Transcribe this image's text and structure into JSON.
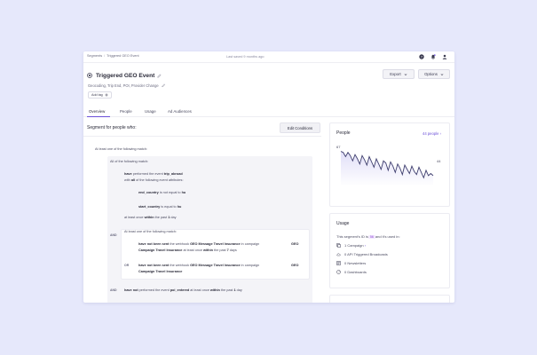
{
  "breadcrumb": {
    "root": "Segments",
    "current": "Triggered GEO Event"
  },
  "last_saved": "Last saved 9 months ago",
  "segment": {
    "title": "Triggered GEO Event",
    "subtitle": "Geocoding, Trip End, POI, Provider Change",
    "add_tag_label": "Add tag"
  },
  "buttons": {
    "export": "Export",
    "options": "Options",
    "edit_conditions": "Edit Conditions"
  },
  "tabs": [
    "Overview",
    "People",
    "Usage",
    "Ad Audiences"
  ],
  "conditions": {
    "heading": "Segment for people who:",
    "top_match": "At least one of the following match:",
    "all_match": "All of the following match:",
    "event1": {
      "pre": "have",
      "mid": " performed the event ",
      "event": "trip_abroad"
    },
    "event1_with": {
      "pre": "with ",
      "all": "all",
      "post": " of the following event attributes:"
    },
    "attr1": {
      "name": "end_country",
      "mid": " is not equal to ",
      "value": "hu"
    },
    "attr2": {
      "name": "start_country",
      "mid": " is equal to ",
      "value": "hu"
    },
    "freq1": {
      "pre": "at least once ",
      "within": "within",
      "mid": " the past ",
      "num": "1",
      "post": " day"
    },
    "and_label": "AND",
    "or_label": "OR",
    "inner_match": "At least one of the following match:",
    "webhook1": {
      "strong": "have not been sent",
      "mid": " the webhook ",
      "name": "GEO Message Travel Insurance",
      "mid2": " in campaign ",
      "campaign": "GEO Campaign Travel Insurance",
      "pre3": " at least once ",
      "within": "within",
      "mid3": " the past ",
      "num": "7",
      "post": " days"
    },
    "webhook2": {
      "strong": "have not been sent",
      "mid": " the webhook ",
      "name": "GEO Message Travel Insurance",
      "mid2": " in campaign ",
      "campaign": "GEO Campaign Travel Insurance"
    },
    "event2": {
      "pre": "have ",
      "not": "not",
      "mid": " performed the event ",
      "event": "poi_entered",
      "pre2": " at least once ",
      "within": "within",
      "mid2": " the past ",
      "num": "1",
      "post": " day"
    }
  },
  "people_card": {
    "title": "People",
    "count_link": "44 people ›",
    "chart_start_label": "67",
    "chart_end_label": "44"
  },
  "chart_data": {
    "type": "line",
    "x": [
      0,
      1,
      2,
      3,
      4,
      5,
      6,
      7,
      8,
      9,
      10,
      11,
      12,
      13,
      14,
      15,
      16,
      17,
      18,
      19,
      20,
      21,
      22,
      23,
      24,
      25,
      26,
      27,
      28,
      29,
      30,
      31,
      32,
      33,
      34,
      35,
      36,
      37,
      38,
      39
    ],
    "series": [
      {
        "values": [
          67,
          66,
          62,
          66,
          63,
          58,
          64,
          60,
          55,
          63,
          59,
          54,
          62,
          57,
          52,
          60,
          55,
          50,
          58,
          56,
          49,
          57,
          53,
          47,
          55,
          51,
          45,
          54,
          50,
          46,
          53,
          48,
          45,
          52,
          47,
          42,
          49,
          44,
          46,
          44
        ]
      }
    ],
    "ylim": [
      38,
      70
    ],
    "grid": false
  },
  "usage_card": {
    "title": "Usage",
    "id_pre": "This segment's ID is ",
    "id_value": "56",
    "id_post": " and it's used in:",
    "items": [
      {
        "icon": "campaign-icon",
        "label": "1 Campaign",
        "suffix": "›"
      },
      {
        "icon": "cloud-icon",
        "label": "0 API Triggered Broadcasts"
      },
      {
        "icon": "newsletter-icon",
        "label": "0 Newsletters"
      },
      {
        "icon": "dashboard-icon",
        "label": "0 Dashboards"
      }
    ]
  },
  "colors": {
    "accent": "#6b4fd8",
    "background": "#e6e8fb",
    "chart_line": "#3e3e6e"
  }
}
